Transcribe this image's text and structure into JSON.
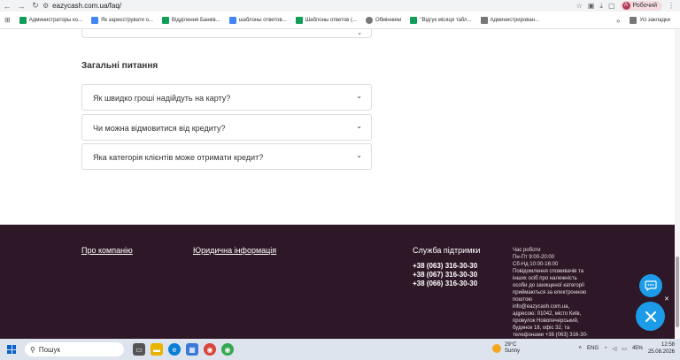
{
  "browser": {
    "back": "←",
    "forward": "→",
    "reload": "↻",
    "url": "eazycash.com.ua/faq/",
    "profile_initial": "A",
    "profile_label": "Робочий"
  },
  "bookmarks": {
    "items": [
      {
        "label": "Администраторы ко...",
        "color": "#0f9d58"
      },
      {
        "label": "Як зареєструвати о...",
        "color": "#4285f4"
      },
      {
        "label": "Відділення Банків...",
        "color": "#0f9d58"
      },
      {
        "label": "шаблоны ответов...",
        "color": "#4285f4"
      },
      {
        "label": "Шаблоны ответов (...",
        "color": "#0f9d58"
      },
      {
        "label": "Обмінники",
        "color": "#777777"
      },
      {
        "label": "\"Відгук місяця табл...",
        "color": "#0f9d58"
      },
      {
        "label": "Администрирован...",
        "color": "#777777"
      }
    ],
    "more": "»",
    "all_bookmarks": "Усі закладки"
  },
  "faq": {
    "section_title": "Загальні питання",
    "questions": [
      "Як швидко гроші надійдуть на карту?",
      "Чи можна відмовитися від кредиту?",
      "Яка категорія клієнтів може отримати кредит?"
    ]
  },
  "footer": {
    "about_link": "Про компанію",
    "legal_link": "Юридична інформація",
    "support_title": "Служба підтримки",
    "phones": [
      "+38 (063) 316-30-30",
      "+38 (067) 316-30-30",
      "+38 (066) 316-30-30"
    ],
    "hours_lines": [
      "Час роботи",
      "Пн-Пт 9:00-20:00",
      "Сб-Нд 10:00-16:00",
      "Повідомлення споживачів та",
      "інших осіб про належність",
      "особи до захищеної категорії",
      "приймаються за електронною",
      "поштою",
      "info@eazycash.com.ua,",
      "адресою: 01042, місто Київ,",
      "провулок Новопечерський,",
      "будинок 18, офіс 32, та",
      "телефонами +38 (063) 316-30-"
    ]
  },
  "taskbar": {
    "search_placeholder": "Пошук",
    "weather_temp": "29°C",
    "weather_desc": "Sunny",
    "lang": "ENG",
    "battery": "45%",
    "time": "12:58",
    "date": "25.08.2026"
  },
  "colors": {
    "footer_bg": "#2e1827",
    "fab": "#1c9be8"
  }
}
